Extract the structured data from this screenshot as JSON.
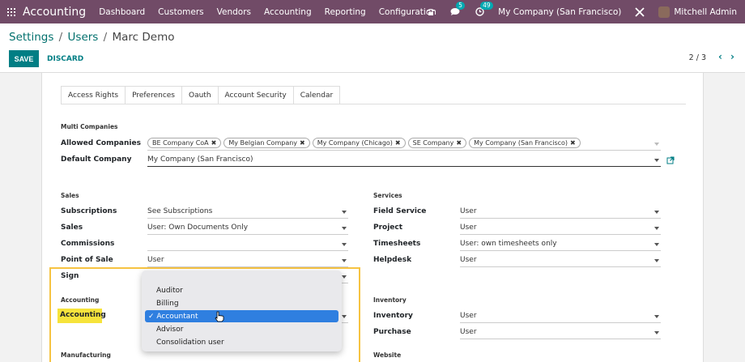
{
  "navbar": {
    "brand": "Accounting",
    "menu": [
      "Dashboard",
      "Customers",
      "Vendors",
      "Accounting",
      "Reporting",
      "Configuration"
    ],
    "messages_count": "5",
    "activities_count": "49",
    "company": "My Company (San Francisco)",
    "user": "Mitchell Admin",
    "icons": [
      "apps-icon",
      "phone-icon",
      "chat-icon",
      "clock-icon",
      "tools-icon"
    ]
  },
  "breadcrumb": {
    "settings": "Settings",
    "users": "Users",
    "current": "Marc Demo",
    "sep": "/"
  },
  "buttons": {
    "save": "SAVE",
    "discard": "DISCARD"
  },
  "pager": {
    "text": "2 / 3",
    "prev": "‹",
    "next": "›"
  },
  "tabs": [
    "Access Rights",
    "Preferences",
    "Oauth",
    "Account Security",
    "Calendar"
  ],
  "multi_companies": {
    "title": "Multi Companies",
    "allowed_label": "Allowed Companies",
    "allowed": [
      "BE Company CoA",
      "My Belgian Company",
      "My Company (Chicago)",
      "SE Company",
      "My Company (San Francisco)"
    ],
    "default_label": "Default Company",
    "default_value": "My Company (San Francisco)"
  },
  "sales": {
    "title": "Sales",
    "subscriptions_label": "Subscriptions",
    "subscriptions_value": "See Subscriptions",
    "sales_label": "Sales",
    "sales_value": "User: Own Documents Only",
    "commissions_label": "Commissions",
    "commissions_value": "",
    "pos_label": "Point of Sale",
    "pos_value": "User",
    "sign_label": "Sign"
  },
  "services": {
    "title": "Services",
    "field_service_label": "Field Service",
    "field_service_value": "User",
    "project_label": "Project",
    "project_value": "User",
    "timesheets_label": "Timesheets",
    "timesheets_value": "User: own timesheets only",
    "helpdesk_label": "Helpdesk",
    "helpdesk_value": "User"
  },
  "accounting": {
    "title": "Accounting",
    "label": "Accounting"
  },
  "inventory": {
    "title": "Inventory",
    "inventory_label": "Inventory",
    "inventory_value": "User",
    "purchase_label": "Purchase",
    "purchase_value": "User"
  },
  "manufacturing": {
    "title": "Manufacturing"
  },
  "website": {
    "title": "Website"
  },
  "dropdown": {
    "options": [
      "Auditor",
      "Billing",
      "Accountant",
      "Advisor",
      "Consolidation user"
    ],
    "selected": "✓ Accountant"
  },
  "colors": {
    "navbar": "#714b67",
    "accent": "#017e84",
    "highlight": "#f6c342",
    "selection": "#2f7fe0"
  }
}
